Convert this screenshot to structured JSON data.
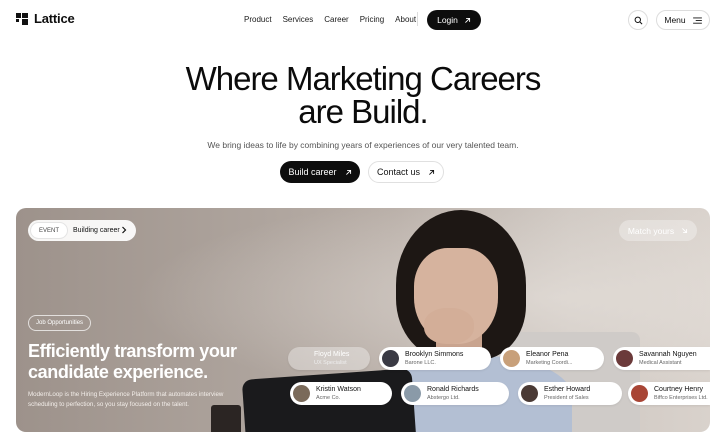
{
  "header": {
    "brand": "Lattice",
    "nav": [
      "Product",
      "Services",
      "Career",
      "Pricing",
      "About"
    ],
    "login_label": "Login",
    "menu_label": "Menu"
  },
  "hero": {
    "title_line1": "Where Marketing Careers",
    "title_line2": "are Build.",
    "subtitle": "We bring ideas to life by combining years of experiences of our very talented team.",
    "primary_cta": "Build career",
    "secondary_cta": "Contact us"
  },
  "banner": {
    "event_tag": "EVENT",
    "event_text": "Building career",
    "match_label": "Match yours",
    "job_tag": "Job Opportunities",
    "title": "Efficiently transform your candidate experience.",
    "description": "ModernLoop is the Hiring Experience Platform that automates interview scheduling to perfection, so you stay focused on the talent.",
    "candidates": [
      {
        "name": "Floyd Miles",
        "role": "UX Specialist",
        "color": "#9a8f87"
      },
      {
        "name": "Brooklyn Simmons",
        "role": "Barone LLC.",
        "color": "#3a3a44"
      },
      {
        "name": "Eleanor Pena",
        "role": "Marketing Coordi...",
        "color": "#c8a07a"
      },
      {
        "name": "Savannah Nguyen",
        "role": "Medical Assistant",
        "color": "#6b3a3a"
      },
      {
        "name": "Kristin Watson",
        "role": "Acme Co.",
        "color": "#7a6a5a"
      },
      {
        "name": "Ronald Richards",
        "role": "Abstergo Ltd.",
        "color": "#8a9aa8"
      },
      {
        "name": "Esther Howard",
        "role": "President of Sales",
        "color": "#4a3a35"
      },
      {
        "name": "Courtney Henry",
        "role": "Biffco Enterprises Ltd.",
        "color": "#a84535"
      }
    ]
  }
}
